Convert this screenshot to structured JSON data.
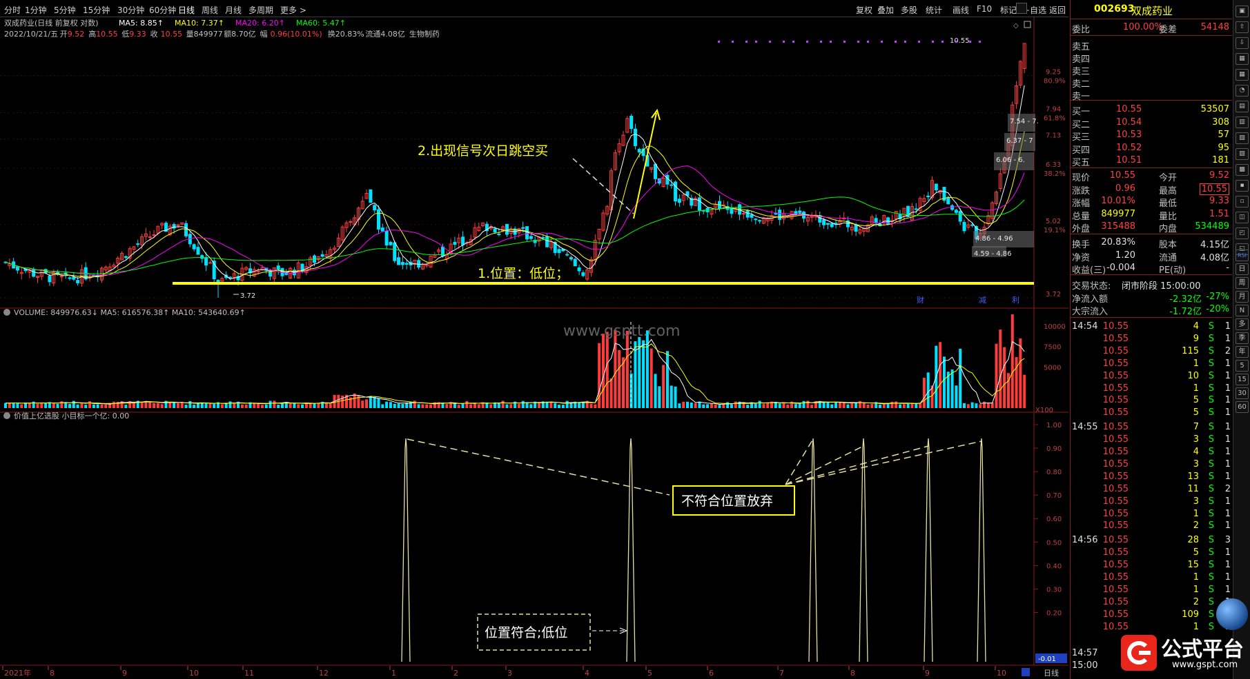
{
  "toolbar": {
    "periods": [
      "分时",
      "1分钟",
      "5分钟",
      "15分钟",
      "30分钟",
      "60分钟",
      "日线",
      "周线",
      "月线",
      "多周期",
      "更多 >"
    ],
    "active": "日线",
    "right_buttons": [
      "复权",
      "叠加",
      "多股",
      "统计",
      "画线",
      "F10",
      "标记",
      "+自选",
      "返回"
    ]
  },
  "chart": {
    "name": "双成药业(日线 前复权 对数)",
    "ma": [
      {
        "label": "MA5: 8.85",
        "color": "#ffffff"
      },
      {
        "label": "MA10: 7.37",
        "color": "#ffff00"
      },
      {
        "label": "MA20: 6.20",
        "color": "#ff00ff"
      },
      {
        "label": "MA60: 5.47",
        "color": "#00ff00"
      }
    ],
    "info_date": "2022/10/21/五",
    "info": [
      {
        "t": "开",
        "c": "#c0c0c0"
      },
      {
        "t": "9.52",
        "c": "#ff4040"
      },
      {
        "t": "高",
        "c": "#c0c0c0"
      },
      {
        "t": "10.55",
        "c": "#ff4040"
      },
      {
        "t": "低",
        "c": "#c0c0c0"
      },
      {
        "t": "9.33",
        "c": "#ff4040"
      },
      {
        "t": "收",
        "c": "#c0c0c0"
      },
      {
        "t": "10.55",
        "c": "#ff4040"
      },
      {
        "t": "量849977",
        "c": "#c0c0c0"
      },
      {
        "t": "额8.70亿",
        "c": "#c0c0c0"
      },
      {
        "t": "幅",
        "c": "#c0c0c0"
      },
      {
        "t": "0.96(10.01%)",
        "c": "#ff4040"
      },
      {
        "t": "换20.83%",
        "c": "#c0c0c0"
      },
      {
        "t": "流通4.08亿",
        "c": "#c0c0c0"
      },
      {
        "t": "生物制药",
        "c": "#c0c0c0"
      }
    ],
    "price_axis": [
      {
        "label": "9.25",
        "pct": "80.9%",
        "price": 9.25
      },
      {
        "label": "7.94",
        "pct": "61.8%",
        "price": 7.94
      },
      {
        "label": "7.13",
        "pct": "",
        "price": 7.13
      },
      {
        "label": "6.33",
        "pct": "38.2%",
        "price": 6.33
      },
      {
        "label": "5.02",
        "pct": "19.1%",
        "price": 5.02
      },
      {
        "label": "3.72",
        "pct": "",
        "price": 3.72
      }
    ],
    "price_labels": [
      "10.55",
      "3.72"
    ],
    "ranges": [
      "7.54 - 7.",
      "6.37 - 7",
      "6.06 - 6.",
      "4.86 - 4.96",
      "4.59 - 4.86"
    ],
    "markers": [
      "财",
      "减",
      "利"
    ],
    "annotations": {
      "signal": "2.出现信号次日跳空买",
      "position": "1.位置：低位；"
    }
  },
  "volume": {
    "header": "VOLUME: 849976.63↓  MA5: 616576.38↑  MA10: 543640.69↑",
    "axis": [
      "10000",
      "7500",
      "5000",
      "X100"
    ],
    "watermark": "www.gsptt.com"
  },
  "indicator": {
    "header": "价值上亿选股  小目标一个亿: 0.00",
    "axis": [
      "1.00",
      "0.90",
      "0.80",
      "0.70",
      "0.60",
      "0.50",
      "0.40",
      "0.30",
      "0.20",
      "-0.01"
    ],
    "box1": "不符合位置放弃",
    "box2": "位置符合;低位"
  },
  "date_axis": {
    "labels": [
      "2021年",
      "8",
      "9",
      "10",
      "11",
      "12",
      "1",
      "2",
      "3",
      "4",
      "5",
      "6",
      "7",
      "8",
      "9",
      "10"
    ],
    "period": "日线"
  },
  "quote": {
    "code": "002693",
    "name": "双成药业",
    "webi_label": "委比",
    "webi": "100.00%",
    "weicha_label": "委差",
    "weicha": "54148",
    "sells": [
      "卖五",
      "卖四",
      "卖三",
      "卖二",
      "卖一"
    ],
    "buys": [
      {
        "label": "买一",
        "price": "10.55",
        "vol": "53507"
      },
      {
        "label": "买二",
        "price": "10.54",
        "vol": "308"
      },
      {
        "label": "买三",
        "price": "10.53",
        "vol": "57"
      },
      {
        "label": "买四",
        "price": "10.52",
        "vol": "95"
      },
      {
        "label": "买五",
        "price": "10.51",
        "vol": "181"
      }
    ],
    "stats": [
      {
        "l1": "现价",
        "v1": "10.55",
        "c1": "#ff4040",
        "l2": "今开",
        "v2": "9.52",
        "c2": "#ff4040"
      },
      {
        "l1": "涨跌",
        "v1": "0.96",
        "c1": "#ff4040",
        "l2": "最高",
        "v2": "10.55",
        "c2": "#ff4040"
      },
      {
        "l1": "涨幅",
        "v1": "10.01%",
        "c1": "#ff4040",
        "l2": "最低",
        "v2": "9.33",
        "c2": "#ff4040"
      },
      {
        "l1": "总量",
        "v1": "849977",
        "c1": "#ffff00",
        "l2": "量比",
        "v2": "1.51",
        "c2": "#ff4040"
      },
      {
        "l1": "外盘",
        "v1": "315488",
        "c1": "#ff4040",
        "l2": "内盘",
        "v2": "534489",
        "c2": "#00ff00"
      }
    ],
    "stats2": [
      {
        "l1": "换手",
        "v1": "20.83%",
        "l2": "股本",
        "v2": "4.15亿"
      },
      {
        "l1": "净资",
        "v1": "1.20",
        "l2": "流通",
        "v2": "4.08亿"
      },
      {
        "l1": "收益(三)",
        "v1": "-0.004",
        "l2": "PE(动)",
        "v2": "-"
      }
    ],
    "status_label": "交易状态:",
    "status": "闭市阶段 15:00:00",
    "flows": [
      {
        "label": "净流入额",
        "val": "-2.32亿",
        "pct": "-27%"
      },
      {
        "label": "大宗流入",
        "val": "-1.72亿",
        "pct": "-20%"
      }
    ],
    "ticks": [
      {
        "time": "14:54",
        "price": "10.55",
        "vol": "4",
        "bs": "S",
        "n": "1"
      },
      {
        "time": "",
        "price": "10.55",
        "vol": "9",
        "bs": "S",
        "n": "1"
      },
      {
        "time": "",
        "price": "10.55",
        "vol": "115",
        "bs": "S",
        "n": "2"
      },
      {
        "time": "",
        "price": "10.55",
        "vol": "1",
        "bs": "S",
        "n": "1"
      },
      {
        "time": "",
        "price": "10.55",
        "vol": "10",
        "bs": "S",
        "n": "1"
      },
      {
        "time": "",
        "price": "10.55",
        "vol": "1",
        "bs": "S",
        "n": "1"
      },
      {
        "time": "",
        "price": "10.55",
        "vol": "5",
        "bs": "S",
        "n": "1"
      },
      {
        "time": "",
        "price": "10.55",
        "vol": "5",
        "bs": "S",
        "n": "1"
      },
      {
        "time": "14:55",
        "price": "10.55",
        "vol": "7",
        "bs": "S",
        "n": "1"
      },
      {
        "time": "",
        "price": "10.55",
        "vol": "3",
        "bs": "S",
        "n": "1"
      },
      {
        "time": "",
        "price": "10.55",
        "vol": "4",
        "bs": "S",
        "n": "1"
      },
      {
        "time": "",
        "price": "10.55",
        "vol": "3",
        "bs": "S",
        "n": "1"
      },
      {
        "time": "",
        "price": "10.55",
        "vol": "13",
        "bs": "S",
        "n": "1"
      },
      {
        "time": "",
        "price": "10.55",
        "vol": "11",
        "bs": "S",
        "n": "2"
      },
      {
        "time": "",
        "price": "10.55",
        "vol": "3",
        "bs": "S",
        "n": "1"
      },
      {
        "time": "",
        "price": "10.55",
        "vol": "1",
        "bs": "S",
        "n": "1"
      },
      {
        "time": "",
        "price": "10.55",
        "vol": "2",
        "bs": "S",
        "n": "1"
      },
      {
        "time": "14:56",
        "price": "10.55",
        "vol": "28",
        "bs": "S",
        "n": "3"
      },
      {
        "time": "",
        "price": "10.55",
        "vol": "5",
        "bs": "S",
        "n": "1"
      },
      {
        "time": "",
        "price": "10.55",
        "vol": "15",
        "bs": "S",
        "n": "1"
      },
      {
        "time": "",
        "price": "10.55",
        "vol": "1",
        "bs": "S",
        "n": "1"
      },
      {
        "time": "",
        "price": "10.55",
        "vol": "1",
        "bs": "S",
        "n": "1"
      },
      {
        "time": "",
        "price": "10.55",
        "vol": "2",
        "bs": "S",
        "n": "1"
      },
      {
        "time": "",
        "price": "10.55",
        "vol": "109",
        "bs": "S",
        "n": "4"
      },
      {
        "time": "",
        "price": "10.55",
        "vol": "1",
        "bs": "S",
        "n": "1"
      },
      {
        "time": "",
        "price": "",
        "vol": "",
        "bs": "",
        "n": ""
      },
      {
        "time": "14:57",
        "price": "",
        "vol": "",
        "bs": "",
        "n": ""
      },
      {
        "time": "15:00",
        "price": "",
        "vol": "",
        "bs": "",
        "n": ""
      }
    ]
  },
  "tools": [
    "RSI",
    "日",
    "周",
    "月",
    "N",
    "多",
    "季",
    "年",
    "5",
    "15",
    "30",
    "60"
  ],
  "logo": {
    "text": "公式平台",
    "url": "www.gspt.com"
  },
  "colors": {
    "up": "#ff3c3c",
    "down": "#00e0ff",
    "ma5": "#ffffff",
    "ma10": "#ffff00",
    "ma20": "#ff00ff",
    "ma60": "#00ff00",
    "accent": "#ffff00"
  }
}
